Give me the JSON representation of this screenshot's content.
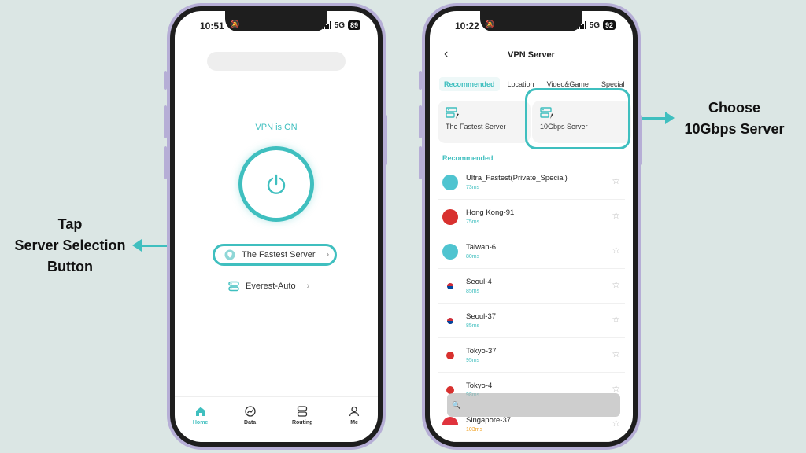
{
  "annotations": {
    "left": [
      "Tap",
      "Server Selection",
      "Button"
    ],
    "right": [
      "Choose",
      "10Gbps Server"
    ],
    "accent": "#3fbfbf"
  },
  "left_phone": {
    "status": {
      "time": "10:51",
      "network": "5G",
      "battery": "89"
    },
    "vpn_status": "VPN is ON",
    "power_icon": "power-icon",
    "server_button": {
      "label": "The Fastest Server",
      "icon": "location-pin-icon"
    },
    "route_button": {
      "label": "Everest-Auto",
      "icon": "route-icon"
    },
    "nav": [
      {
        "label": "Home",
        "icon": "home-icon",
        "active": true
      },
      {
        "label": "Data",
        "icon": "chart-icon",
        "active": false
      },
      {
        "label": "Routing",
        "icon": "routing-icon",
        "active": false
      },
      {
        "label": "Me",
        "icon": "user-icon",
        "active": false
      }
    ]
  },
  "right_phone": {
    "status": {
      "time": "10:22",
      "network": "5G",
      "battery": "92"
    },
    "title": "VPN Server",
    "tabs": [
      "Recommended",
      "Location",
      "Video&Game",
      "Special"
    ],
    "active_tab": "Recommended",
    "cards": [
      {
        "label": "The Fastest Server",
        "icon": "server-rocket-icon"
      },
      {
        "label": "10Gbps Server",
        "icon": "server-rocket-icon"
      }
    ],
    "section_label": "Recommended",
    "servers": [
      {
        "name": "Ultra_Fastest(Private_Special)",
        "ping": "73ms",
        "flag": "globe"
      },
      {
        "name": "Hong Kong-91",
        "ping": "75ms",
        "flag": "hk"
      },
      {
        "name": "Taiwan-6",
        "ping": "80ms",
        "flag": "globe"
      },
      {
        "name": "Seoul-4",
        "ping": "85ms",
        "flag": "kr"
      },
      {
        "name": "Seoul-37",
        "ping": "85ms",
        "flag": "kr"
      },
      {
        "name": "Tokyo-37",
        "ping": "95ms",
        "flag": "jp"
      },
      {
        "name": "Tokyo-4",
        "ping": "98ms",
        "flag": "jp"
      },
      {
        "name": "Singapore-37",
        "ping": "103ms",
        "flag": "sg"
      }
    ]
  }
}
